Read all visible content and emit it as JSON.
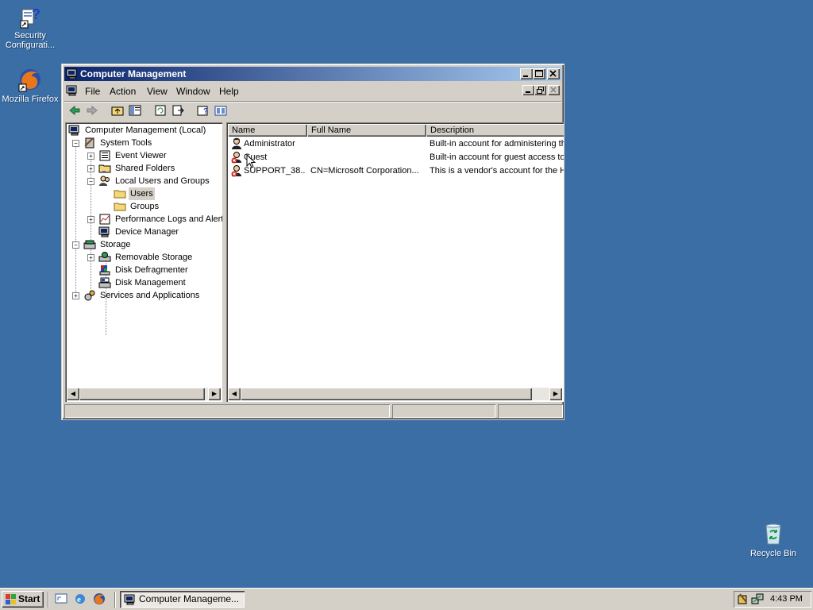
{
  "desktop": {
    "icons": [
      {
        "label": "Security Configurati..."
      },
      {
        "label": "Mozilla Firefox"
      },
      {
        "label": "Recycle Bin"
      }
    ]
  },
  "window": {
    "title": "Computer Management",
    "menu": [
      "File",
      "Action",
      "View",
      "Window",
      "Help"
    ],
    "tree": [
      {
        "label": "Computer Management (Local)"
      },
      {
        "label": "System Tools"
      },
      {
        "label": "Event Viewer"
      },
      {
        "label": "Shared Folders"
      },
      {
        "label": "Local Users and Groups"
      },
      {
        "label": "Users"
      },
      {
        "label": "Groups"
      },
      {
        "label": "Performance Logs and Alerts"
      },
      {
        "label": "Device Manager"
      },
      {
        "label": "Storage"
      },
      {
        "label": "Removable Storage"
      },
      {
        "label": "Disk Defragmenter"
      },
      {
        "label": "Disk Management"
      },
      {
        "label": "Services and Applications"
      }
    ],
    "columns": [
      "Name",
      "Full Name",
      "Description"
    ],
    "rows": [
      {
        "name": "Administrator",
        "full_name": "",
        "description": "Built-in account for administering th"
      },
      {
        "name": "Guest",
        "full_name": "",
        "description": "Built-in account for guest access to"
      },
      {
        "name": "SUPPORT_38...",
        "full_name": "CN=Microsoft Corporation...",
        "description": "This is a vendor's account for the H"
      }
    ]
  },
  "taskbar": {
    "start_label": "Start",
    "task_label": "Computer Manageme...",
    "clock": "4:43 PM"
  }
}
